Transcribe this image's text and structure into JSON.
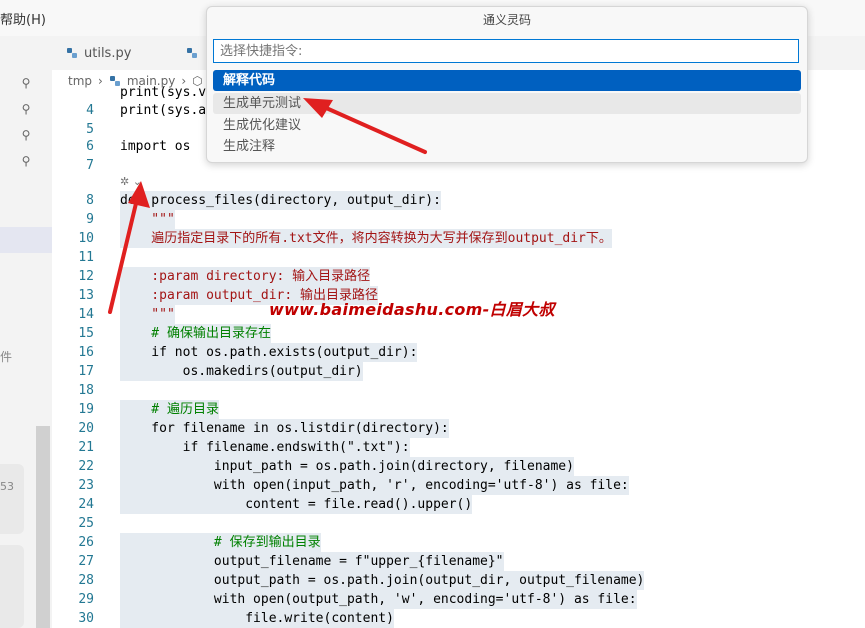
{
  "menu": {
    "help_label": "帮助(H)"
  },
  "tabs": [
    {
      "label": "utils.py",
      "icon": "python-icon"
    },
    {
      "label": "",
      "icon": "python-icon"
    }
  ],
  "breadcrumb": {
    "folder": "tmp",
    "file": "main.py"
  },
  "left": {
    "num": "53",
    "char": "件"
  },
  "quickpick": {
    "title": "通义灵码",
    "placeholder": "选择快捷指令:",
    "items": [
      "解释代码",
      "生成单元测试",
      "生成优化建议",
      "生成注释"
    ],
    "active_index": 0
  },
  "watermark": "www.baimeidashu.com-白眉大叔",
  "editor": {
    "lines": [
      {
        "n": "",
        "text": "print(sys.v"
      },
      {
        "n": "4",
        "text": "print(sys.a"
      },
      {
        "n": "5",
        "text": ""
      },
      {
        "n": "6",
        "text": "import os"
      },
      {
        "n": "7",
        "text": ""
      },
      {
        "n": "8",
        "text": "def process_files(directory, output_dir):"
      },
      {
        "n": "9",
        "text": "    \"\"\""
      },
      {
        "n": "10",
        "text": "    遍历指定目录下的所有.txt文件，将内容转换为大写并保存到output_dir下。"
      },
      {
        "n": "11",
        "text": ""
      },
      {
        "n": "12",
        "text": "    :param directory: 输入目录路径"
      },
      {
        "n": "13",
        "text": "    :param output_dir: 输出目录路径"
      },
      {
        "n": "14",
        "text": "    \"\"\""
      },
      {
        "n": "15",
        "text": "    # 确保输出目录存在"
      },
      {
        "n": "16",
        "text": "    if not os.path.exists(output_dir):"
      },
      {
        "n": "17",
        "text": "        os.makedirs(output_dir)"
      },
      {
        "n": "18",
        "text": ""
      },
      {
        "n": "19",
        "text": "    # 遍历目录"
      },
      {
        "n": "20",
        "text": "    for filename in os.listdir(directory):"
      },
      {
        "n": "21",
        "text": "        if filename.endswith(\".txt\"):"
      },
      {
        "n": "22",
        "text": "            input_path = os.path.join(directory, filename)"
      },
      {
        "n": "23",
        "text": "            with open(input_path, 'r', encoding='utf-8') as file:"
      },
      {
        "n": "24",
        "text": "                content = file.read().upper()"
      },
      {
        "n": "25",
        "text": ""
      },
      {
        "n": "26",
        "text": "            # 保存到输出目录"
      },
      {
        "n": "27",
        "text": "            output_filename = f\"upper_{filename}\""
      },
      {
        "n": "28",
        "text": "            output_path = os.path.join(output_dir, output_filename)"
      },
      {
        "n": "29",
        "text": "            with open(output_path, 'w', encoding='utf-8') as file:"
      },
      {
        "n": "30",
        "text": "                file.write(content)"
      }
    ]
  },
  "colors": {
    "accent": "#0060c0",
    "arrow": "#e02020",
    "watermark": "#c00000"
  }
}
